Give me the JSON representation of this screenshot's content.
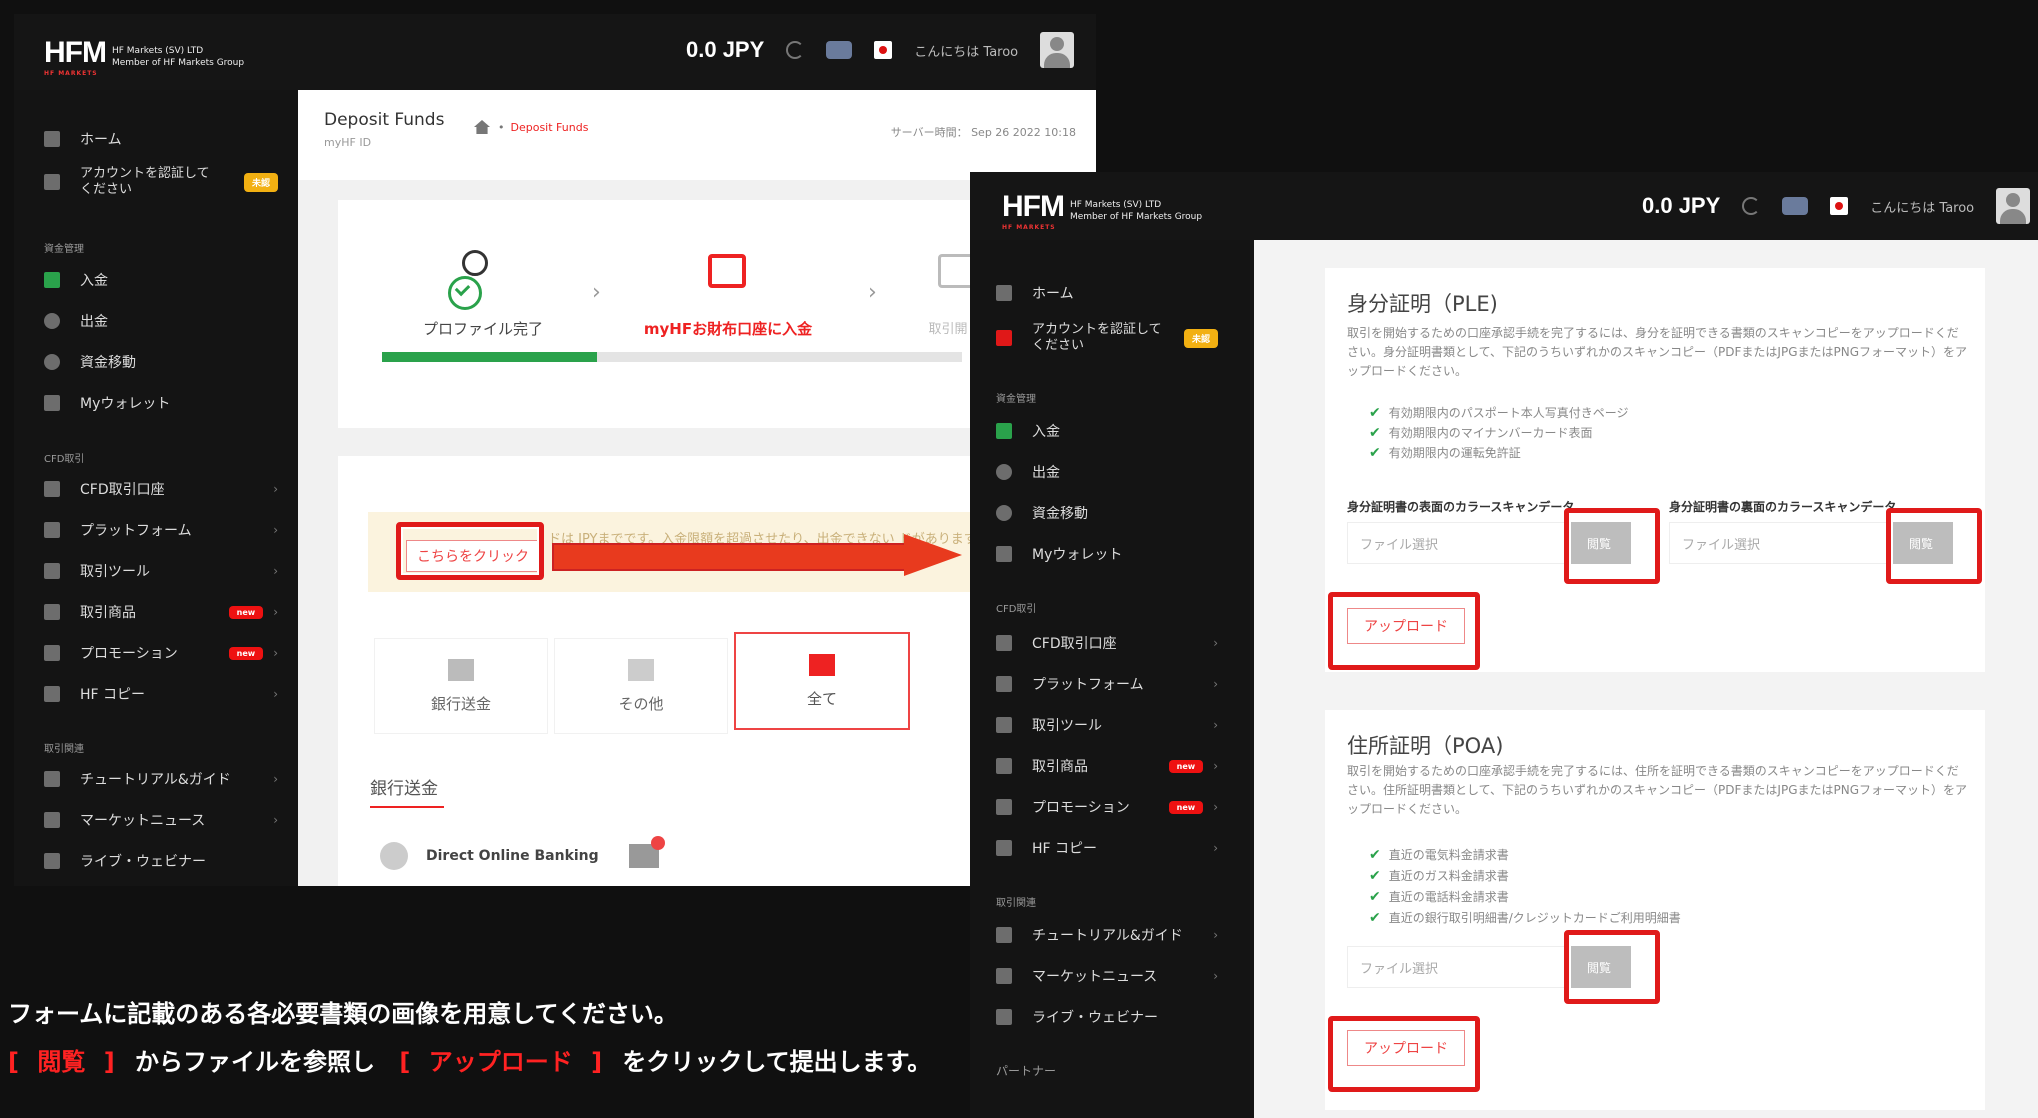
{
  "brand": {
    "logo": "HFM",
    "sub1": "HF Markets (SV) LTD",
    "sub2": "Member of HF Markets Group",
    "tag": "HF MARKETS"
  },
  "topbar": {
    "balance": "0.0 JPY",
    "greeting": "こんにちは Taroo"
  },
  "sidebar": {
    "home": "ホーム",
    "verify_line1": "アカウントを認証して",
    "verify_line2": "ください",
    "verify_badge": "未認",
    "sec_funds": "資金管理",
    "deposit": "入金",
    "withdraw": "出金",
    "transfer": "資金移動",
    "wallet": "Myウォレット",
    "sec_cfd": "CFD取引",
    "cfd_account": "CFD取引口座",
    "platform": "プラットフォーム",
    "tools": "取引ツール",
    "products": "取引商品",
    "promotions": "プロモーション",
    "copy": "HF コピー",
    "sec_edu": "取引関連",
    "tutorial": "チュートリアル&ガイド",
    "news": "マーケットニュース",
    "webinar": "ライブ・ウェビナー",
    "sec_partner": "パートナー",
    "new_badge": "new"
  },
  "deposit_page": {
    "title": "Deposit Funds",
    "subtitle": "myHF ID",
    "breadcrumb": "Deposit Funds",
    "server_time": "サーバー時間： Sep 26 2022 10:18",
    "step1": "プロファイル完了",
    "step2": "myHFお財布口座に入金",
    "step3": "取引開",
    "banner_text": "ドは JPYまでです。入金限額を超過させたり、出金できない ドがあります",
    "click_here": "こちらをクリック",
    "opt_bank": "銀行送金",
    "opt_other": "その他",
    "opt_all": "全て",
    "section_bank": "銀行送金",
    "direct_banking": "Direct Online Banking"
  },
  "verification": {
    "ple_title": "身分証明（PLE)",
    "ple_desc": "取引を開始するための口座承認手続を完了するには、身分を証明できる書類のスキャンコピーをアップロードください。身分証明書類として、下記のうちいずれかのスキャンコピー（PDFまたはJPGまたはPNGフォーマット）をアップロードください。",
    "ple_items": [
      "有効期限内のパスポート本人写真付きページ",
      "有効期限内のマイナンバーカード表面",
      "有効期限内の運転免許証"
    ],
    "front_label": "身分証明書の表面のカラースキャンデータ",
    "back_label": "身分証明書の裏面のカラースキャンデータ",
    "file_placeholder": "ファイル選択",
    "browse": "閲覧",
    "upload": "アップロード",
    "poa_title": "住所証明（POA)",
    "poa_desc": "取引を開始するための口座承認手続を完了するには、住所を証明できる書類のスキャンコピーをアップロードください。住所証明書類として、下記のうちいずれかのスキャンコピー（PDFまたはJPGまたはPNGフォーマット）をアップロードください。",
    "poa_items": [
      "直近の電気料金請求書",
      "直近のガス料金請求書",
      "直近の電話料金請求書",
      "直近の銀行取引明細書/クレジットカードご利用明細書"
    ]
  },
  "caption": {
    "line1": "フォームに記載のある各必要書類の画像を用意してください。",
    "open1": "[",
    "browse": "閲覧",
    "close1": "]",
    "mid": "からファイルを参照し",
    "open2": "[",
    "upload": "アップロード",
    "close2": "]",
    "tail": "をクリックして提出します。"
  },
  "colors": {
    "accent_red": "#e01a1a",
    "green": "#2aa24b",
    "badge_yellow": "#f2b012"
  }
}
